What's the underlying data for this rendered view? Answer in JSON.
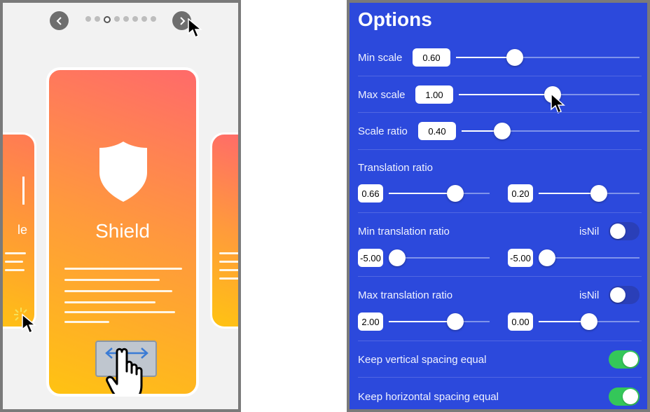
{
  "carousel": {
    "card_title": "Shield",
    "left_card_partial_text": "le",
    "page_dots": 8,
    "active_dot": 2
  },
  "options": {
    "title": "Options",
    "min_scale": {
      "label": "Min scale",
      "value": "0.60",
      "fraction": 0.32
    },
    "max_scale": {
      "label": "Max scale",
      "value": "1.00",
      "fraction": 0.52
    },
    "scale_ratio": {
      "label": "Scale ratio",
      "value": "0.40",
      "fraction": 0.23
    },
    "translation_ratio": {
      "label": "Translation ratio",
      "x": {
        "value": "0.66",
        "fraction": 0.66
      },
      "y": {
        "value": "0.20",
        "fraction": 0.6
      }
    },
    "min_translation_ratio": {
      "label": "Min translation ratio",
      "isnil_label": "isNil",
      "x": {
        "value": "-5.00",
        "fraction": 0.0
      },
      "y": {
        "value": "-5.00",
        "fraction": 0.0
      }
    },
    "max_translation_ratio": {
      "label": "Max translation ratio",
      "isnil_label": "isNil",
      "x": {
        "value": "2.00",
        "fraction": 0.66
      },
      "y": {
        "value": "0.00",
        "fraction": 0.5
      }
    },
    "keep_vertical": {
      "label": "Keep vertical spacing equal",
      "on": true
    },
    "keep_horizontal": {
      "label": "Keep horizontal spacing equal",
      "on": true
    }
  },
  "colors": {
    "panel_bg": "#2c49dc",
    "toggle_on": "#34c759",
    "card_gradient_start": "#ff6a6a",
    "card_gradient_end": "#ffc312"
  }
}
